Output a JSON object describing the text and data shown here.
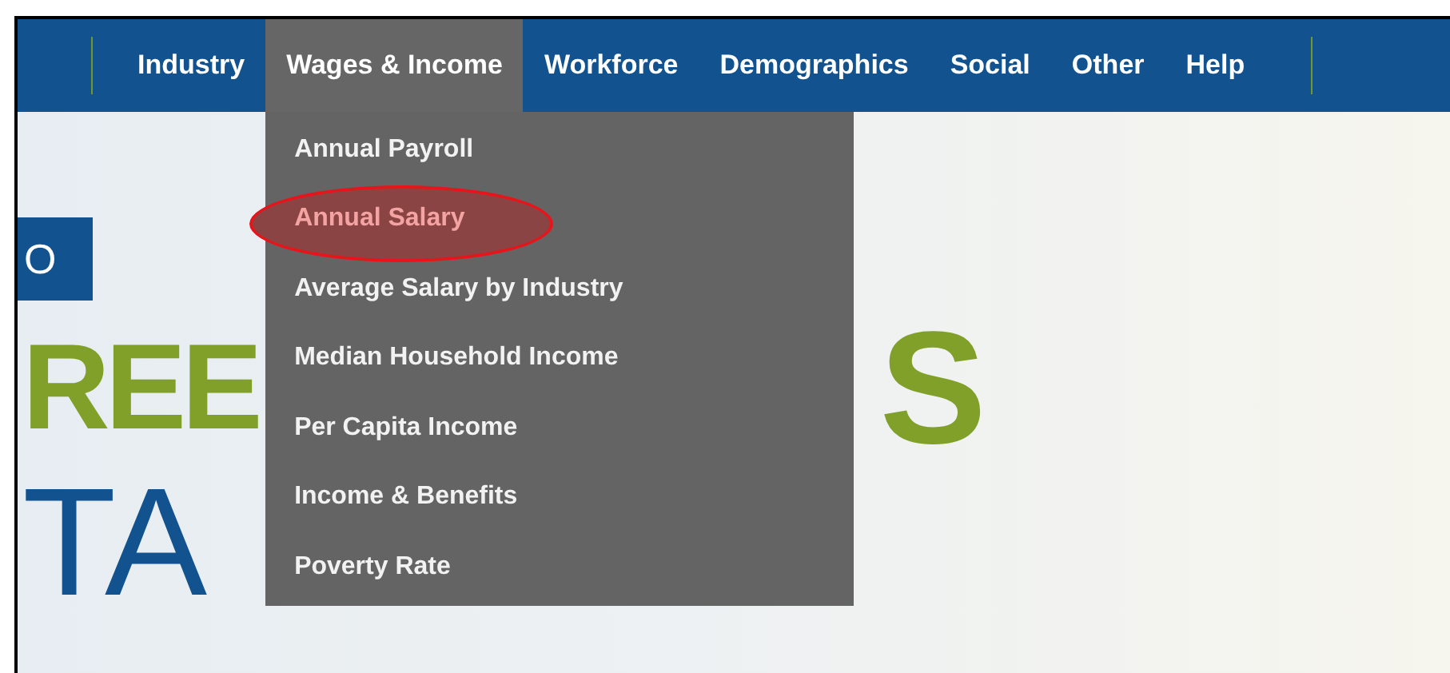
{
  "nav": {
    "items": [
      {
        "label": "Industry",
        "selected": false
      },
      {
        "label": "Wages & Income",
        "selected": true,
        "menu": [
          {
            "label": "Annual Payroll",
            "selected": false
          },
          {
            "label": "Annual Salary",
            "selected": true
          },
          {
            "label": "Average Salary by Industry",
            "selected": false
          },
          {
            "label": "Median Household Income",
            "selected": false
          },
          {
            "label": "Per Capita Income",
            "selected": false
          },
          {
            "label": "Income & Benefits",
            "selected": false
          },
          {
            "label": "Poverty Rate",
            "selected": false
          }
        ]
      },
      {
        "label": "Workforce",
        "selected": false
      },
      {
        "label": "Demographics",
        "selected": false
      },
      {
        "label": "Social",
        "selected": false
      },
      {
        "label": "Other",
        "selected": false
      },
      {
        "label": "Help",
        "selected": false
      }
    ]
  },
  "hero": {
    "badge": "O",
    "title_left": "REE",
    "title_right": "S",
    "subtitle": "TA"
  }
}
